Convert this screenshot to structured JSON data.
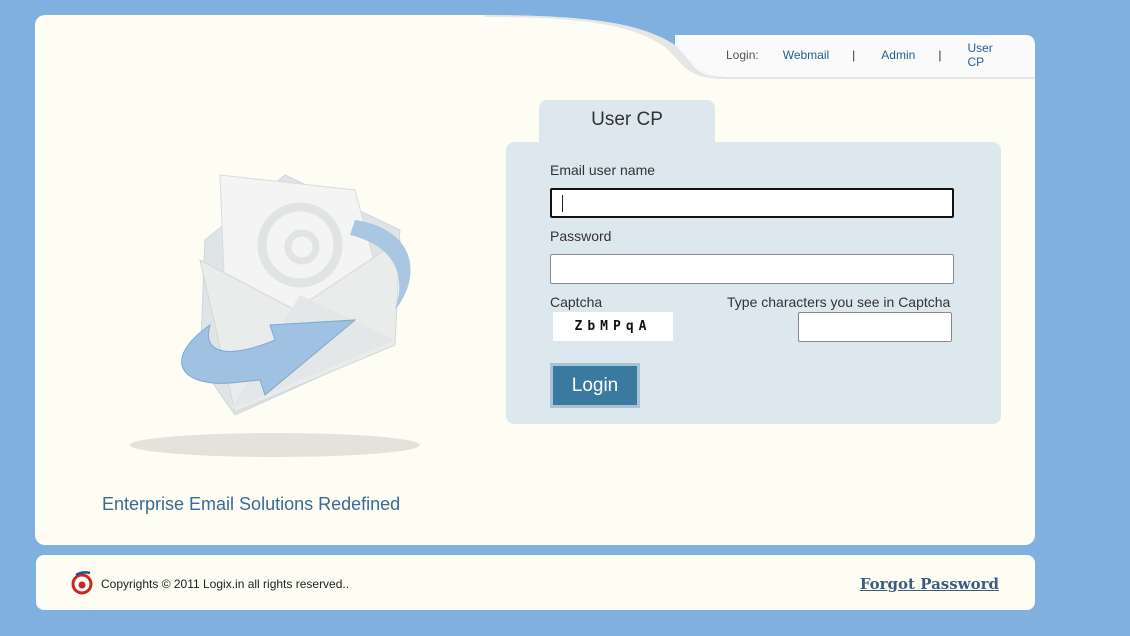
{
  "topnav": {
    "login_label": "Login:",
    "links": [
      "Webmail",
      "Admin",
      "User CP"
    ],
    "separator": "|"
  },
  "tagline": "Enterprise Email Solutions Redefined",
  "login_panel": {
    "tab_title": "User CP",
    "email_label": "Email user name",
    "email_value": "",
    "password_label": "Password",
    "password_value": "",
    "captcha_label": "Captcha",
    "captcha_text": "ZbMPqA",
    "captcha_prompt": "Type characters you see in Captcha",
    "captcha_value": "",
    "login_button": "Login"
  },
  "footer": {
    "copyright": "Copyrights © 2011 Logix.in all rights reserved..",
    "forgot_password": "Forgot Password"
  },
  "colors": {
    "page_bg": "#7fb0e0",
    "panel_bg": "#fdfdf4",
    "form_bg": "#dde8ee",
    "button_bg": "#3a7aa0",
    "link": "#1f5f95"
  }
}
